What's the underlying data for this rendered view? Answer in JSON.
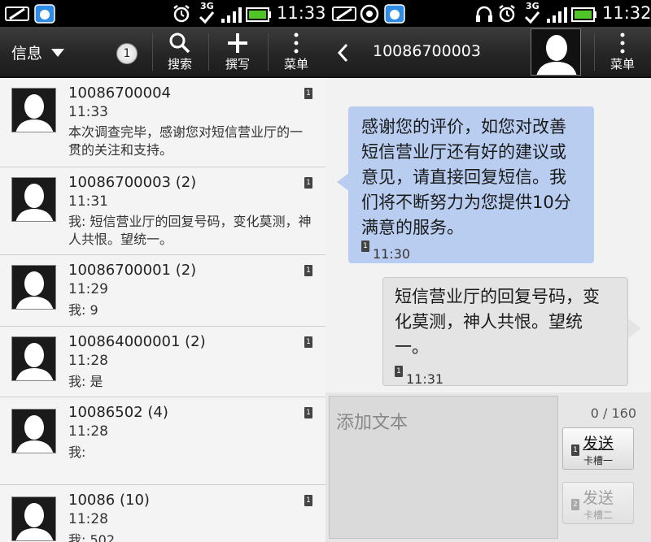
{
  "left": {
    "status": {
      "time": "11:33",
      "network": "3G"
    },
    "actionbar": {
      "title": "信息",
      "unread_count": "1",
      "search_label": "搜索",
      "compose_label": "撰写",
      "menu_label": "菜单"
    },
    "conversations": [
      {
        "name": "10086700004",
        "time": "11:33",
        "snippet": "本次调查完毕，感谢您对短信营业厅的一贯的关注和支持。"
      },
      {
        "name": "10086700003 (2)",
        "time": "11:31",
        "snippet": "我: 短信营业厅的回复号码，变化莫测，神人共恨。望统一。"
      },
      {
        "name": "10086700001 (2)",
        "time": "11:29",
        "snippet": "我: 9"
      },
      {
        "name": "100864000001 (2)",
        "time": "11:28",
        "snippet": "我: 是"
      },
      {
        "name": "10086502 (4)",
        "time": "11:28",
        "snippet": "我:"
      },
      {
        "name": "10086 (10)",
        "time": "11:28",
        "snippet": "我: 502"
      }
    ]
  },
  "right": {
    "status": {
      "time": "11:32",
      "network": "3G"
    },
    "actionbar": {
      "title": "10086700003",
      "menu_label": "菜单"
    },
    "messages": [
      {
        "direction": "in",
        "text": "感谢您的评价，如您对改善短信营业厅还有好的建议或意见，请直接回复短信。我们将不断努力为您提供10分满意的服务。",
        "time": "11:30"
      },
      {
        "direction": "out",
        "text": "短信营业厅的回复号码，变化莫测，神人共恨。望统一。",
        "time": "11:31"
      }
    ],
    "composer": {
      "placeholder": "添加文本",
      "counter": "0 / 160",
      "send1_label": "发送",
      "send1_sub": "卡槽一",
      "send2_label": "发送",
      "send2_sub": "卡槽二"
    }
  },
  "colors": {
    "incoming_bubble": "#b8cdf0",
    "outgoing_bubble": "#e4e4e4",
    "battery": "#4fc528"
  }
}
